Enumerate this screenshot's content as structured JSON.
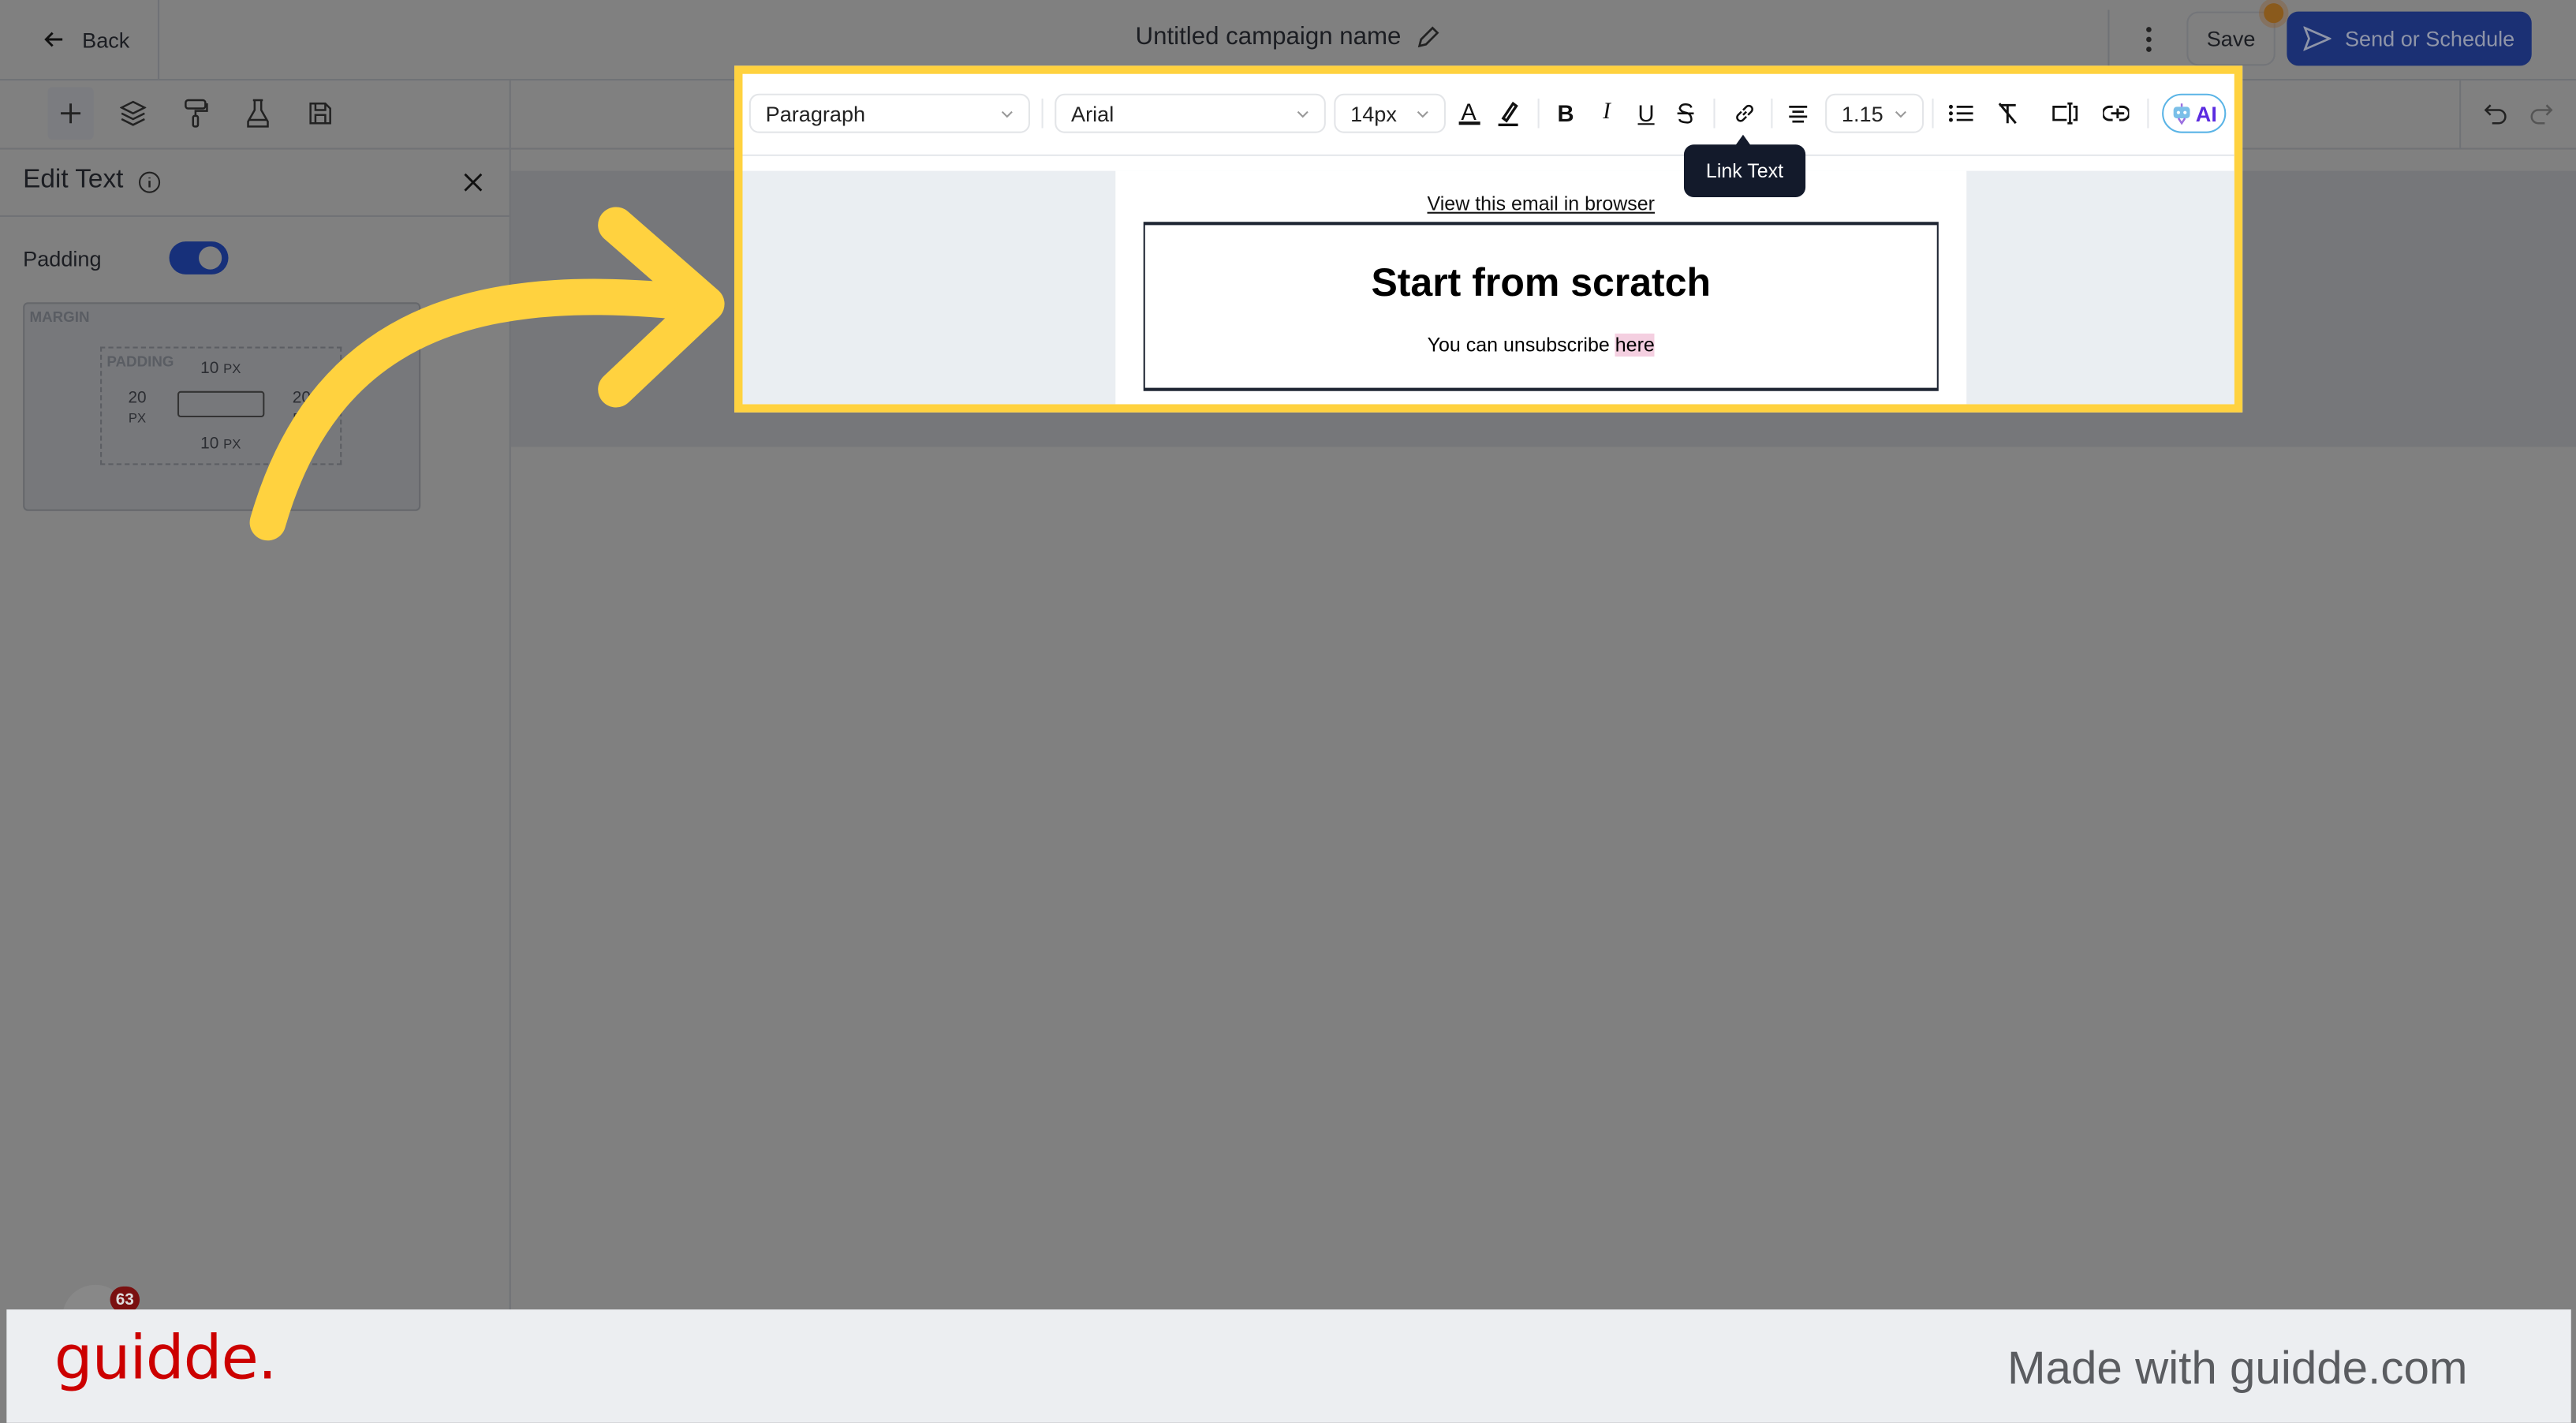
{
  "header": {
    "back_label": "Back",
    "campaign_title": "Untitled campaign name",
    "save_label": "Save",
    "send_label": "Send or Schedule",
    "accent_color": "#1b3687"
  },
  "toolbar_left": {
    "icons": [
      "plus-icon",
      "layers-icon",
      "paint-roller-icon",
      "flask-icon",
      "save-disk-icon"
    ]
  },
  "panel": {
    "title": "Edit Text",
    "padding_label": "Padding",
    "padding_toggle_on": true,
    "margin_label": "MARGIN",
    "padding_box_label": "PADDING",
    "padding_top": "10",
    "padding_bottom": "10",
    "padding_left": "20",
    "padding_right": "20",
    "unit": "PX"
  },
  "editor_toolbar": {
    "block_type": "Paragraph",
    "font": "Arial",
    "font_size": "14px",
    "line_height": "1.15",
    "ai_label": "AI",
    "bold": "B",
    "italic": "I",
    "underline": "U",
    "text_color_glyph": "A",
    "tooltip": "Link Text"
  },
  "email": {
    "view_in_browser": "View this email in browser",
    "heading": "Start from scratch",
    "body_text": "You can unsubscribe",
    "link_text": "here"
  },
  "notification_badge": "63",
  "footer": {
    "logo": "guidde.",
    "tagline": "Made with guidde.com",
    "logo_color": "#cc0000"
  },
  "highlight_color": "#ffd23f"
}
